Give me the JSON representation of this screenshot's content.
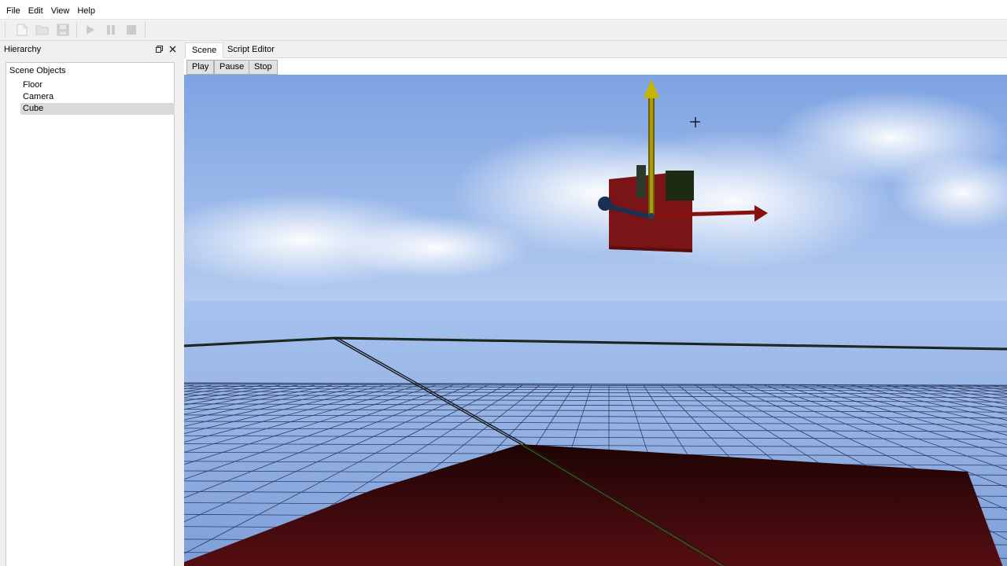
{
  "menu": {
    "file": "File",
    "edit": "Edit",
    "view": "View",
    "help": "Help"
  },
  "toolbar": {
    "icons": [
      "new-file-icon",
      "open-folder-icon",
      "save-icon",
      "play-icon",
      "pause-icon",
      "stop-icon"
    ]
  },
  "hierarchy": {
    "title": "Hierarchy",
    "root": "Scene Objects",
    "items": [
      {
        "label": "Floor",
        "selected": false
      },
      {
        "label": "Camera",
        "selected": false
      },
      {
        "label": "Cube",
        "selected": true
      }
    ]
  },
  "tabs": [
    {
      "label": "Scene",
      "active": true
    },
    {
      "label": "Script Editor",
      "active": false
    }
  ],
  "controls": {
    "play": "Play",
    "pause": "Pause",
    "stop": "Stop"
  },
  "colors": {
    "sky_top": "#7fa4e0",
    "sky_horizon": "#b8cff0",
    "ground_grid": "#2d3e66",
    "floor_plane": "#2a0707",
    "cube": "#7a1416",
    "gizmo_y": "#c8b400",
    "gizmo_x": "#8a1010",
    "gizmo_z": "#1a3050"
  }
}
